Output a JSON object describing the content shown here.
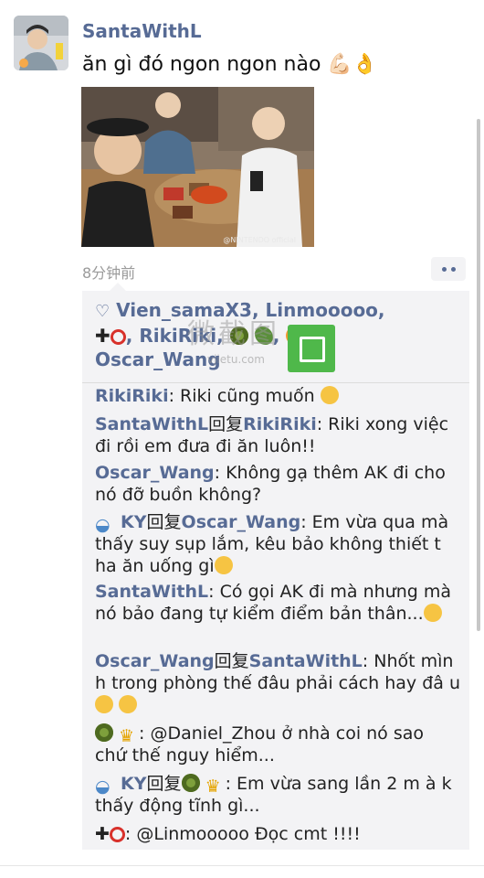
{
  "post": {
    "username": "SantaWithL",
    "text": "ăn gì đó ngon ngon nào 💪🏻👌",
    "photo_watermark": "@NINTENDO official",
    "timestamp": "8分钟前"
  },
  "likes": {
    "names": [
      "Vien_samaX3,",
      "Linmooooo,",
      "RikiRiki,",
      "Oscar_Wang"
    ]
  },
  "comments": [
    {
      "author": "RikiRiki",
      "reply_to": "",
      "text": ": Riki cũng muốn"
    },
    {
      "author": "SantaWithL",
      "reply_word": "回复",
      "reply_to": "RikiRiki",
      "text": ": Riki xong việc đi rồi em đưa đi ăn luôn!!"
    },
    {
      "author": "Oscar_Wang",
      "reply_to": "",
      "text": ": Không gạ thêm AK đi cho nó đỡ buồn không?"
    },
    {
      "author": "KY",
      "reply_word": "回复",
      "reply_to": "Oscar_Wang",
      "text": ": Em vừa qua mà thấy suy sụp lắm, kêu bảo không thiết t ha ăn uống gì"
    },
    {
      "author": "SantaWithL",
      "reply_to": "",
      "text": ": Có gọi AK đi mà nhưng mà nó bảo đang tự kiểm điểm bản thân..."
    },
    {
      "author": "Oscar_Wang",
      "reply_word": "回复",
      "reply_to": "SantaWithL",
      "text": ": Nhốt mìn h trong phòng thế đâu phải cách hay đâ u"
    },
    {
      "author": "",
      "reply_to": "",
      "text": ": @Daniel_Zhou ở nhà coi nó sao chứ thế nguy hiểm..."
    },
    {
      "author": "KY",
      "reply_word": "回复",
      "reply_to": "",
      "text": ": Em vừa sang lần 2 m à k thấy động tĩnh gì..."
    },
    {
      "author": "",
      "reply_to": "",
      "text": ": @Linmooooo Đọc cmt !!!!"
    }
  ],
  "watermark": {
    "text": "微截图",
    "url": "vjietu.com"
  },
  "colors": {
    "link": "#576b95",
    "box": "#f3f3f5"
  }
}
